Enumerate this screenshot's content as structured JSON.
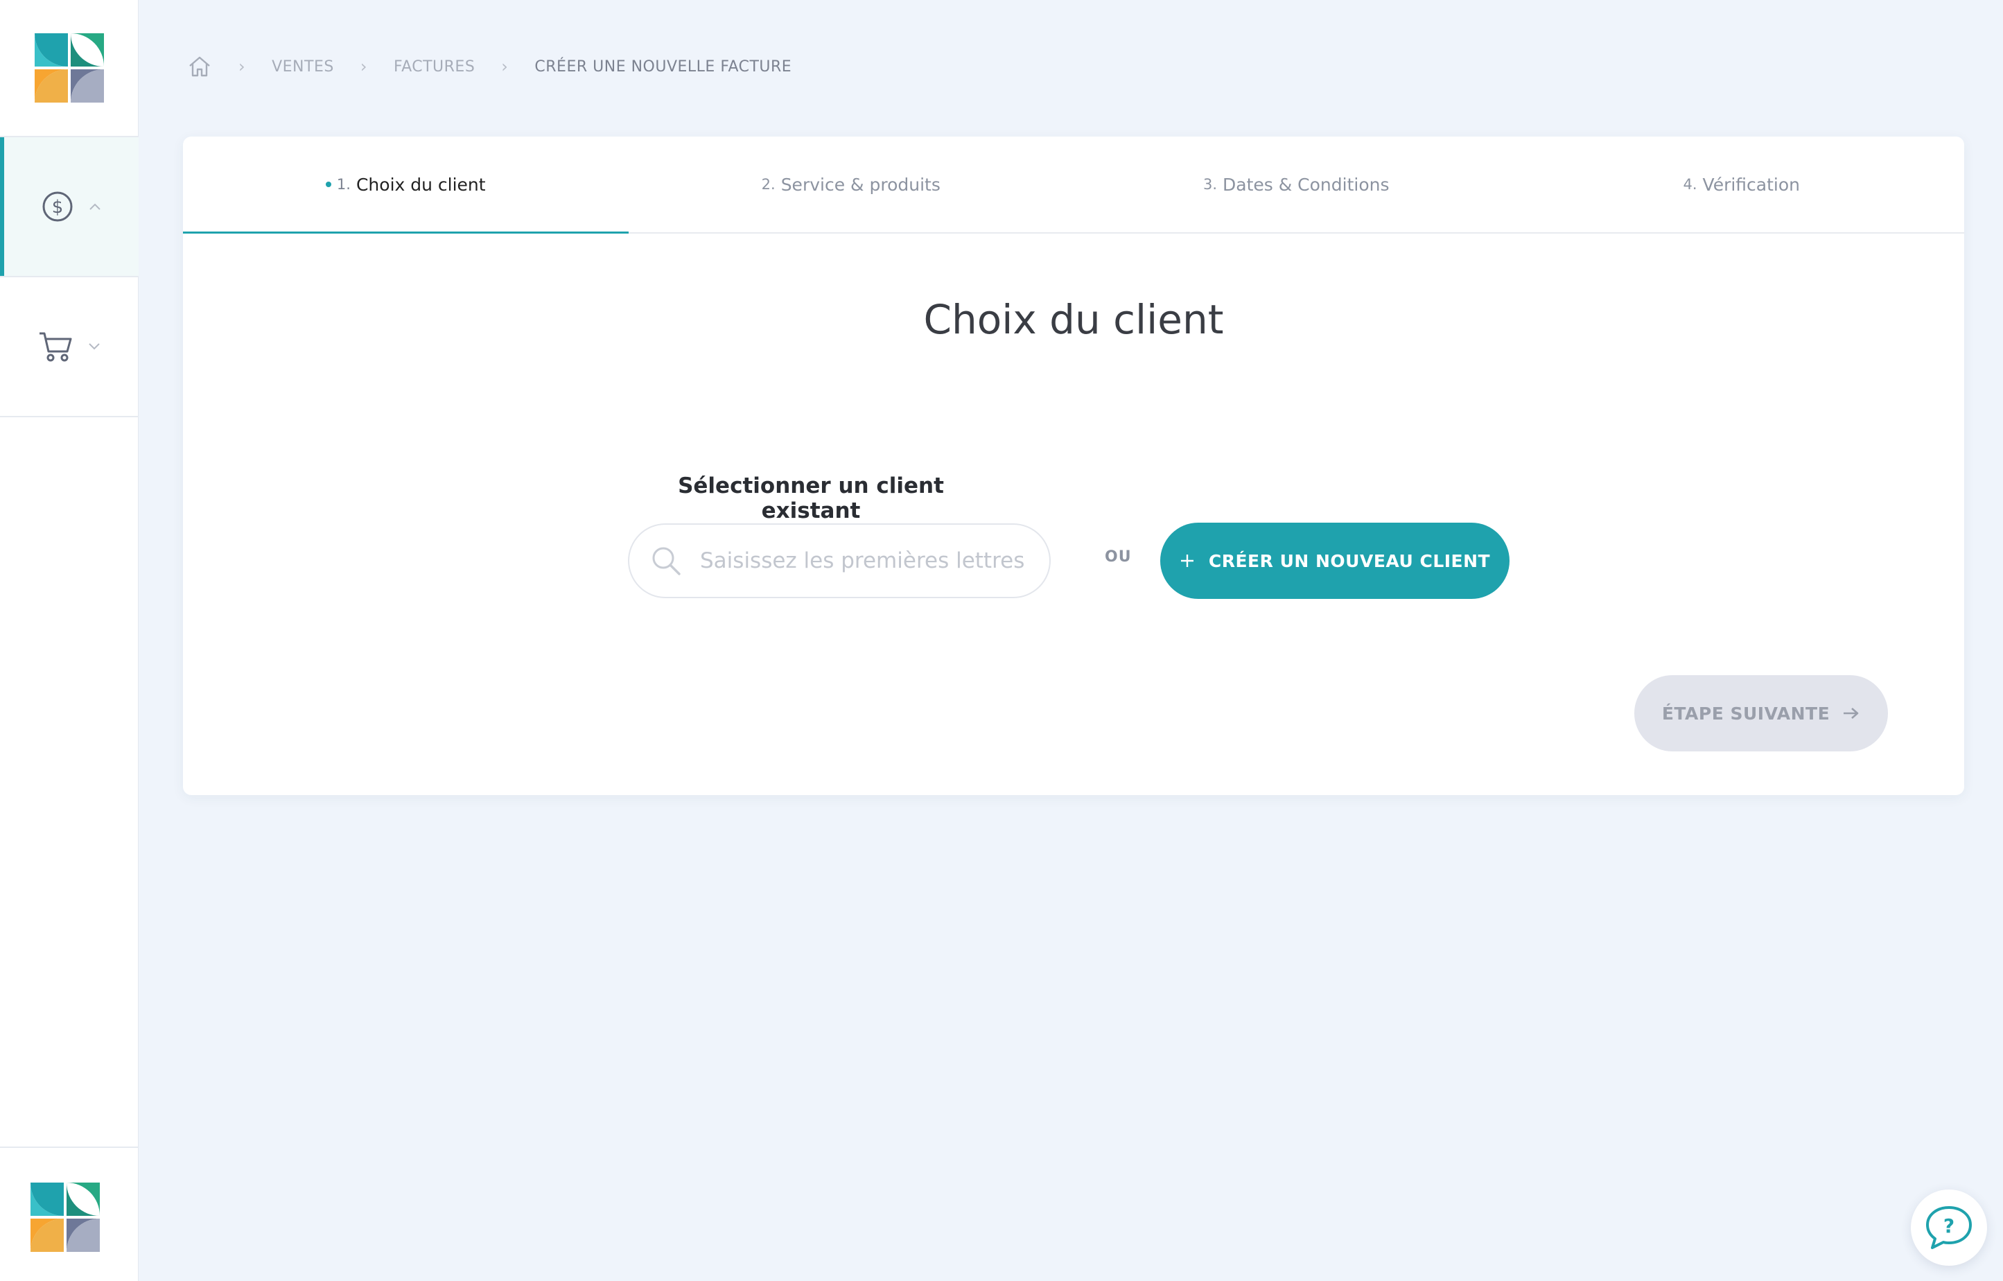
{
  "sidebar": {
    "items": [
      {
        "name": "ventes",
        "icon": "dollar-circle-icon",
        "expanded": true
      },
      {
        "name": "achats",
        "icon": "shopping-cart-icon",
        "expanded": false
      }
    ]
  },
  "breadcrumb": {
    "items": [
      "VENTES",
      "FACTURES",
      "CRÉER UNE NOUVELLE FACTURE"
    ]
  },
  "wizard": {
    "steps": [
      {
        "num": "1.",
        "label": "Choix du client",
        "active": true
      },
      {
        "num": "2.",
        "label": "Service & produits",
        "active": false
      },
      {
        "num": "3.",
        "label": "Dates & Conditions",
        "active": false
      },
      {
        "num": "4.",
        "label": "Vérification",
        "active": false
      }
    ],
    "title": "Choix du client",
    "select_label": "Sélectionner un client existant",
    "search_placeholder": "Saisissez les premières lettres",
    "or_label": "ou",
    "create_button": "CRÉER UN NOUVEAU CLIENT",
    "next_button": "ÉTAPE SUIVANTE"
  },
  "colors": {
    "accent": "#1fa2ad",
    "background": "#eff4fb",
    "disabled": "#e2e4ec"
  }
}
